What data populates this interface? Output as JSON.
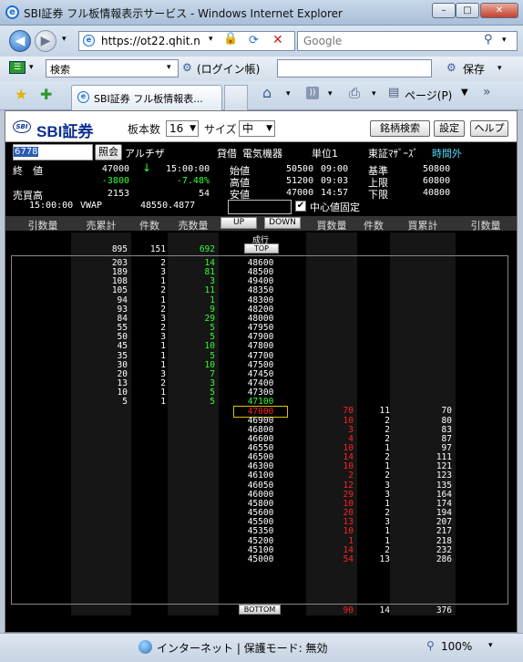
{
  "window": {
    "title": "SBI証券 フル板情報表示サービス - Windows Internet Explorer",
    "min": "–",
    "max": "□",
    "close": "✕"
  },
  "address": {
    "url": "https://ot22.qhit.n",
    "search_placeholder": "Google"
  },
  "toolbar2": {
    "search_label": "検索",
    "login": "(ログイン帳)",
    "save": "保存"
  },
  "tabs": {
    "active": "SBI証券 フル板情報表...",
    "page": "ページ(P)"
  },
  "sbi": {
    "logo": "SBI証券",
    "mark": "SBI",
    "board_label": "板本数",
    "board_value": "16",
    "size_label": "サイズ",
    "size_value": "中",
    "search_btn": "銘柄検索",
    "settings_btn": "設定",
    "help_btn": "ヘルプ"
  },
  "stock": {
    "code": "6778",
    "lookup": "照会",
    "name": "アルチザ",
    "margin": "貸借",
    "sector": "電気機器",
    "unit": "単位1",
    "market": "東証ﾏｻﾞｰｽﾞ",
    "session": "時間外"
  },
  "quote": {
    "close_label": "終　値",
    "close": "47000",
    "arrow": "↓",
    "close_time": "15:00:00",
    "change": "-3800",
    "change_pct": "-7.48%",
    "volume_label": "売買高",
    "volume": "2153",
    "volume2": "54",
    "vwap_time": "15:00:00",
    "vwap_label": "VWAP",
    "vwap": "48550.4877",
    "open_label": "始値",
    "open": "50500",
    "open_time": "09:00",
    "high_label": "高値",
    "high": "51200",
    "high_time": "09:03",
    "low_label": "安値",
    "low": "47000",
    "low_time": "14:57",
    "base_label": "基準",
    "base": "50800",
    "upper_label": "上限",
    "upper": "60800",
    "lower_label": "下限",
    "lower": "40800",
    "center_fix": "中心値固定"
  },
  "columns": {
    "h1": "引数量",
    "h2": "売累計",
    "h3": "件数",
    "h4": "売数量",
    "up": "UP",
    "down": "DOWN",
    "h5": "買数量",
    "h6": "件数",
    "h7": "買累計",
    "h8": "引数量"
  },
  "book": {
    "market_order": "成行",
    "top": "TOP",
    "bottom": "BOTTOM",
    "top_row": {
      "sell_cum": "895",
      "sell_cnt": "151",
      "sell_qty": "692"
    },
    "asks": [
      {
        "cum": "203",
        "cnt": "2",
        "qty": "14",
        "price": "48600"
      },
      {
        "cum": "189",
        "cnt": "3",
        "qty": "81",
        "price": "48500"
      },
      {
        "cum": "108",
        "cnt": "1",
        "qty": "3",
        "price": "49400"
      },
      {
        "cum": "105",
        "cnt": "2",
        "qty": "11",
        "price": "48350"
      },
      {
        "cum": "94",
        "cnt": "1",
        "qty": "1",
        "price": "48300"
      },
      {
        "cum": "93",
        "cnt": "2",
        "qty": "9",
        "price": "48200"
      },
      {
        "cum": "84",
        "cnt": "3",
        "qty": "29",
        "price": "48000"
      },
      {
        "cum": "55",
        "cnt": "2",
        "qty": "5",
        "price": "47950"
      },
      {
        "cum": "50",
        "cnt": "3",
        "qty": "5",
        "price": "47900"
      },
      {
        "cum": "45",
        "cnt": "1",
        "qty": "10",
        "price": "47800"
      },
      {
        "cum": "35",
        "cnt": "1",
        "qty": "5",
        "price": "47700"
      },
      {
        "cum": "30",
        "cnt": "1",
        "qty": "10",
        "price": "47500"
      },
      {
        "cum": "20",
        "cnt": "3",
        "qty": "7",
        "price": "47450"
      },
      {
        "cum": "13",
        "cnt": "2",
        "qty": "3",
        "price": "47400"
      },
      {
        "cum": "10",
        "cnt": "1",
        "qty": "5",
        "price": "47300"
      },
      {
        "cum": "5",
        "cnt": "1",
        "qty": "5",
        "price": "47100"
      }
    ],
    "bids": [
      {
        "price": "47000",
        "qty": "70",
        "cnt": "11",
        "cum": "70"
      },
      {
        "price": "46900",
        "qty": "10",
        "cnt": "2",
        "cum": "80"
      },
      {
        "price": "46800",
        "qty": "3",
        "cnt": "2",
        "cum": "83"
      },
      {
        "price": "46600",
        "qty": "4",
        "cnt": "2",
        "cum": "87"
      },
      {
        "price": "46550",
        "qty": "10",
        "cnt": "1",
        "cum": "97"
      },
      {
        "price": "46500",
        "qty": "14",
        "cnt": "2",
        "cum": "111"
      },
      {
        "price": "46300",
        "qty": "10",
        "cnt": "1",
        "cum": "121"
      },
      {
        "price": "46100",
        "qty": "2",
        "cnt": "2",
        "cum": "123"
      },
      {
        "price": "46050",
        "qty": "12",
        "cnt": "3",
        "cum": "135"
      },
      {
        "price": "46000",
        "qty": "29",
        "cnt": "3",
        "cum": "164"
      },
      {
        "price": "45800",
        "qty": "10",
        "cnt": "1",
        "cum": "174"
      },
      {
        "price": "45600",
        "qty": "20",
        "cnt": "2",
        "cum": "194"
      },
      {
        "price": "45500",
        "qty": "13",
        "cnt": "3",
        "cum": "207"
      },
      {
        "price": "45350",
        "qty": "10",
        "cnt": "1",
        "cum": "217"
      },
      {
        "price": "45200",
        "qty": "1",
        "cnt": "1",
        "cum": "218"
      },
      {
        "price": "45100",
        "qty": "14",
        "cnt": "2",
        "cum": "232"
      },
      {
        "price": "45000",
        "qty": "54",
        "cnt": "13",
        "cum": "286"
      }
    ],
    "bottom_row": {
      "buy_qty": "90",
      "buy_cnt": "14",
      "buy_cum": "376"
    }
  },
  "status": {
    "zone": "インターネット | 保護モード: 無効",
    "zoom": "100%"
  }
}
